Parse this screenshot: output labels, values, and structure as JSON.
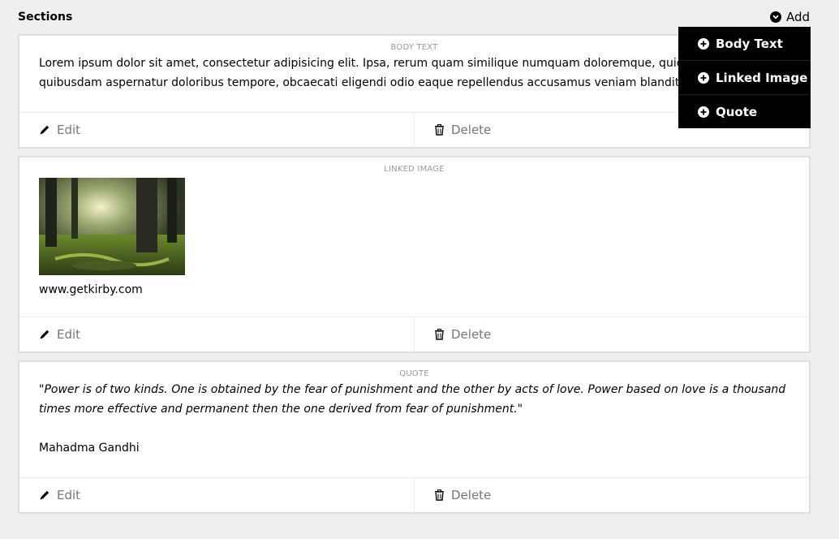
{
  "header": {
    "title": "Sections",
    "add_label": "Add"
  },
  "sections": [
    {
      "label": "BODY TEXT",
      "text_line1": "Lorem ipsum dolor sit amet, consectetur adipisicing elit. Ipsa, rerum quam similique numquam doloremque, quidem s",
      "text_line2": "quibusdam aspernatur doloribus tempore, obcaecati eligendi odio eaque repellendus accusamus veniam blanditiis im",
      "edit_label": "Edit",
      "delete_label": "Delete"
    },
    {
      "label": "LINKED IMAGE",
      "link": "www.getkirby.com",
      "edit_label": "Edit",
      "delete_label": "Delete"
    },
    {
      "label": "QUOTE",
      "quote": "\"Power is of two kinds. One is obtained by the fear of punishment and the other by acts of love. Power based on love is a thousand times more effective and permanent then the one derived from fear of punishment.\"",
      "author": "Mahadma Gandhi",
      "edit_label": "Edit",
      "delete_label": "Delete"
    }
  ],
  "dropdown": {
    "items": [
      {
        "label": "Body Text",
        "icon": "plus-circle-icon"
      },
      {
        "label": "Linked Image",
        "icon": "plus-circle-icon"
      },
      {
        "label": "Quote",
        "icon": "plus-circle-icon"
      }
    ]
  },
  "colors": {
    "background": "#efefef",
    "card_border": "#dedede",
    "dropdown_bg": "#000000",
    "muted_text": "#777777"
  }
}
